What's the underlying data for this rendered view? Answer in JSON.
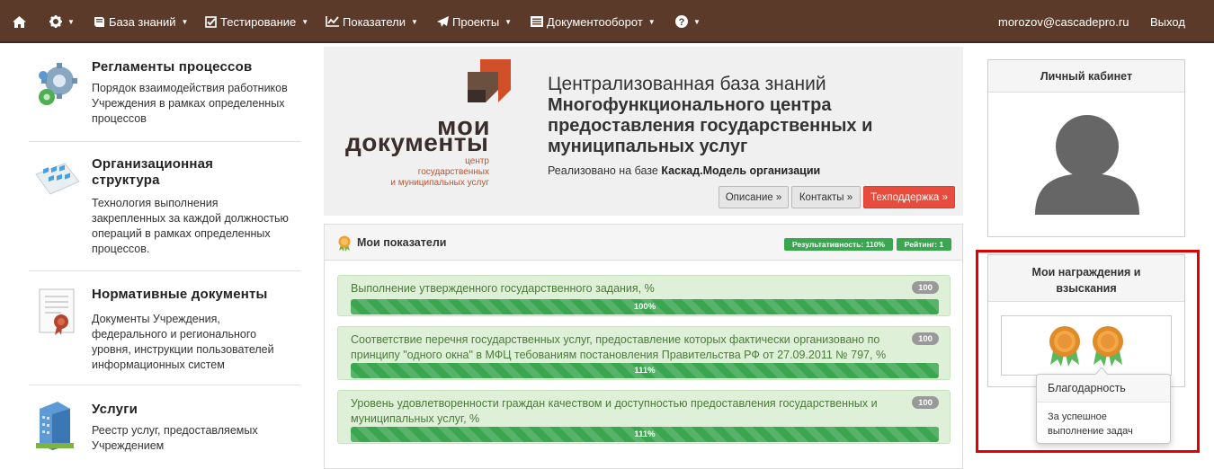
{
  "navbar": {
    "items": [
      {
        "label": ""
      },
      {
        "label": ""
      },
      {
        "label": "База знаний"
      },
      {
        "label": "Тестирование"
      },
      {
        "label": "Показатели"
      },
      {
        "label": "Проекты"
      },
      {
        "label": "Документооборот"
      },
      {
        "label": ""
      }
    ],
    "user_email": "morozov@cascadepro.ru",
    "logout_label": "Выход",
    "icons": [
      "home-icon",
      "gear-icon",
      "book-icon",
      "check-square-icon",
      "line-chart-icon",
      "paper-plane-icon",
      "document-list-icon",
      "question-circle-icon"
    ]
  },
  "modules": [
    {
      "title": "Регламенты процессов",
      "desc": "Порядок взаимодействия работников Учреждения в рамках определенных процессов",
      "icon": "gears-icon"
    },
    {
      "title": "Организационная структура",
      "desc": "Технология выполнения закрепленных за каждой должностью операций в рамках определенных процессов.",
      "icon": "org-structure-icon"
    },
    {
      "title": "Нормативные документы",
      "desc": "Документы Учреждения, федерального и регионального уровня, инструкции пользователей информационных систем",
      "icon": "certificate-icon"
    },
    {
      "title": "Услуги",
      "desc": "Реестр услуг, предоставляемых Учреждением",
      "icon": "building-icon"
    }
  ],
  "hero": {
    "logo": {
      "word1": "мои",
      "word2": "документы",
      "small_line1": "центр",
      "small_line2": "государственных",
      "small_line3": "и муниципальных услуг"
    },
    "title_light": "Централизованная база знаний",
    "title_bold": "Многофункционального центра предоставления государственных и муниципальных услуг",
    "subtitle_prefix": "Реализовано на базе ",
    "subtitle_bold": "Каскад.Модель организации",
    "buttons": {
      "description": "Описание »",
      "contacts": "Контакты »",
      "support": "Техподдержка »"
    }
  },
  "indicators": {
    "title": "Мои показатели",
    "badge_effectiveness": "Результативность: 110%",
    "badge_rating": "Рейтинг: 1",
    "items": [
      {
        "text": "Выполнение утвержденного государственного задания, %",
        "badge": "100",
        "progress_label": "100%",
        "progress": 1.0
      },
      {
        "text": "Соответствие перечня государственных услуг, предоставление которых фактически организовано по принципу \"одного окна\" в МФЦ тебованиям постановления Правительства РФ от 27.09.2011 № 797, %",
        "badge": "100",
        "progress_label": "111%",
        "progress": 1.0
      },
      {
        "text": "Уровень удовлетворенности граждан качеством и доступностью предоставления государственных и муниципальных услуг, %",
        "badge": "100",
        "progress_label": "111%",
        "progress": 1.0
      }
    ]
  },
  "profile": {
    "title": "Личный кабинет"
  },
  "awards": {
    "title": "Мои награждения и взыскания",
    "popover_title": "Благодарность",
    "popover_body": "За успешное выполнение задач"
  },
  "colors": {
    "navbar": "#5c3a2a",
    "success": "#3aa64f",
    "danger": "#e74c3c",
    "highlight": "#e20000"
  }
}
